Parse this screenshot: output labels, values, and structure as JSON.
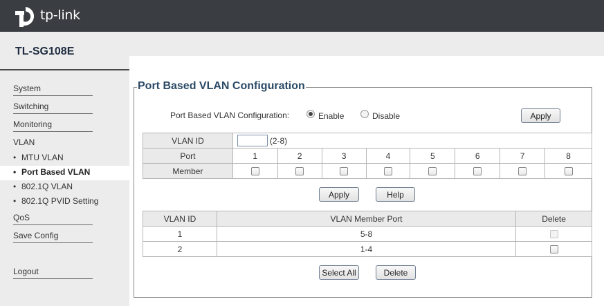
{
  "brand": {
    "logo_text": "tp-link",
    "model": "TL-SG108E"
  },
  "sidebar": {
    "items": [
      {
        "label": "System"
      },
      {
        "label": "Switching"
      },
      {
        "label": "Monitoring"
      },
      {
        "label": "VLAN"
      },
      {
        "label": "QoS"
      },
      {
        "label": "Save Config"
      },
      {
        "label": "Logout"
      }
    ],
    "vlan_subitems": [
      {
        "label": "MTU VLAN",
        "active": false
      },
      {
        "label": "Port Based VLAN",
        "active": true
      },
      {
        "label": "802.1Q VLAN",
        "active": false
      },
      {
        "label": "802.1Q PVID Setting",
        "active": false
      }
    ],
    "bullet": "•"
  },
  "main": {
    "section_title": "Port Based VLAN Configuration",
    "config_label": "Port Based VLAN Configuration:",
    "enable_label": "Enable",
    "disable_label": "Disable",
    "selected_mode": "Enable",
    "apply_top": "Apply",
    "vlan_id_label": "VLAN ID",
    "vlan_id_value": "",
    "vlan_id_range": "(2-8)",
    "port_label": "Port",
    "member_label": "Member",
    "ports": [
      "1",
      "2",
      "3",
      "4",
      "5",
      "6",
      "7",
      "8"
    ],
    "apply_btn": "Apply",
    "help_btn": "Help",
    "list_headers": {
      "vlan_id": "VLAN ID",
      "member_port": "VLAN Member Port",
      "delete": "Delete"
    },
    "list_rows": [
      {
        "vlan_id": "1",
        "member_port": "5-8",
        "deletable": false
      },
      {
        "vlan_id": "2",
        "member_port": "1-4",
        "deletable": true
      }
    ],
    "select_all_btn": "Select All",
    "delete_btn": "Delete"
  },
  "colors": {
    "topbar": "#3a3d42",
    "title": "#2b4a66",
    "sidebar_bg": "#ececec"
  }
}
